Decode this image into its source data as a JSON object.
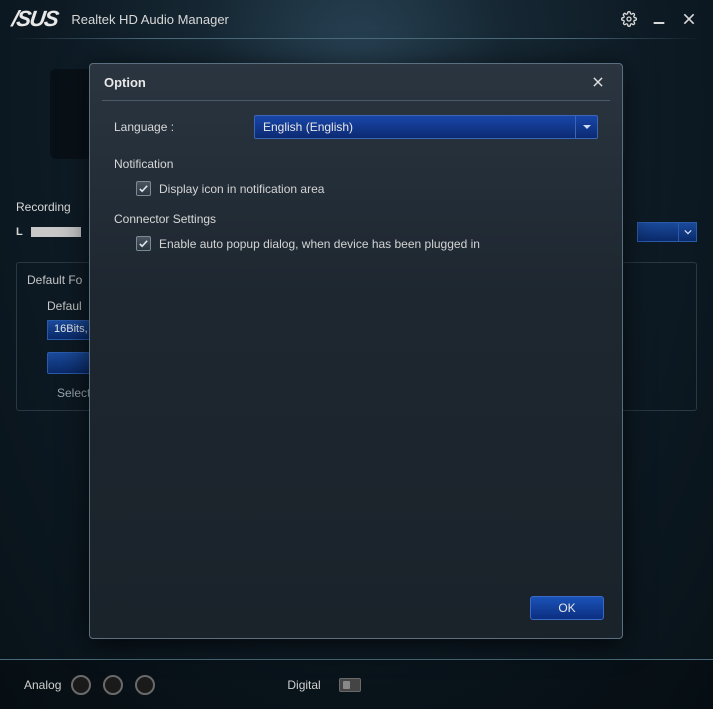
{
  "titlebar": {
    "app_title": "Realtek HD Audio Manager"
  },
  "background": {
    "recording_label": "Recording",
    "l_letter": "L",
    "default_group_title": "Default Fo",
    "default_field_label": "Defaul",
    "bits_value": "16Bits,",
    "select_hint": "Select"
  },
  "bottom": {
    "analog_label": "Analog",
    "digital_label": "Digital"
  },
  "modal": {
    "title": "Option",
    "language_label": "Language :",
    "language_value": "English (English)",
    "notification_label": "Notification",
    "notify_checkbox_label": "Display icon in notification area",
    "connector_label": "Connector Settings",
    "connector_checkbox_label": "Enable auto popup dialog, when device has been plugged in",
    "ok_label": "OK"
  }
}
